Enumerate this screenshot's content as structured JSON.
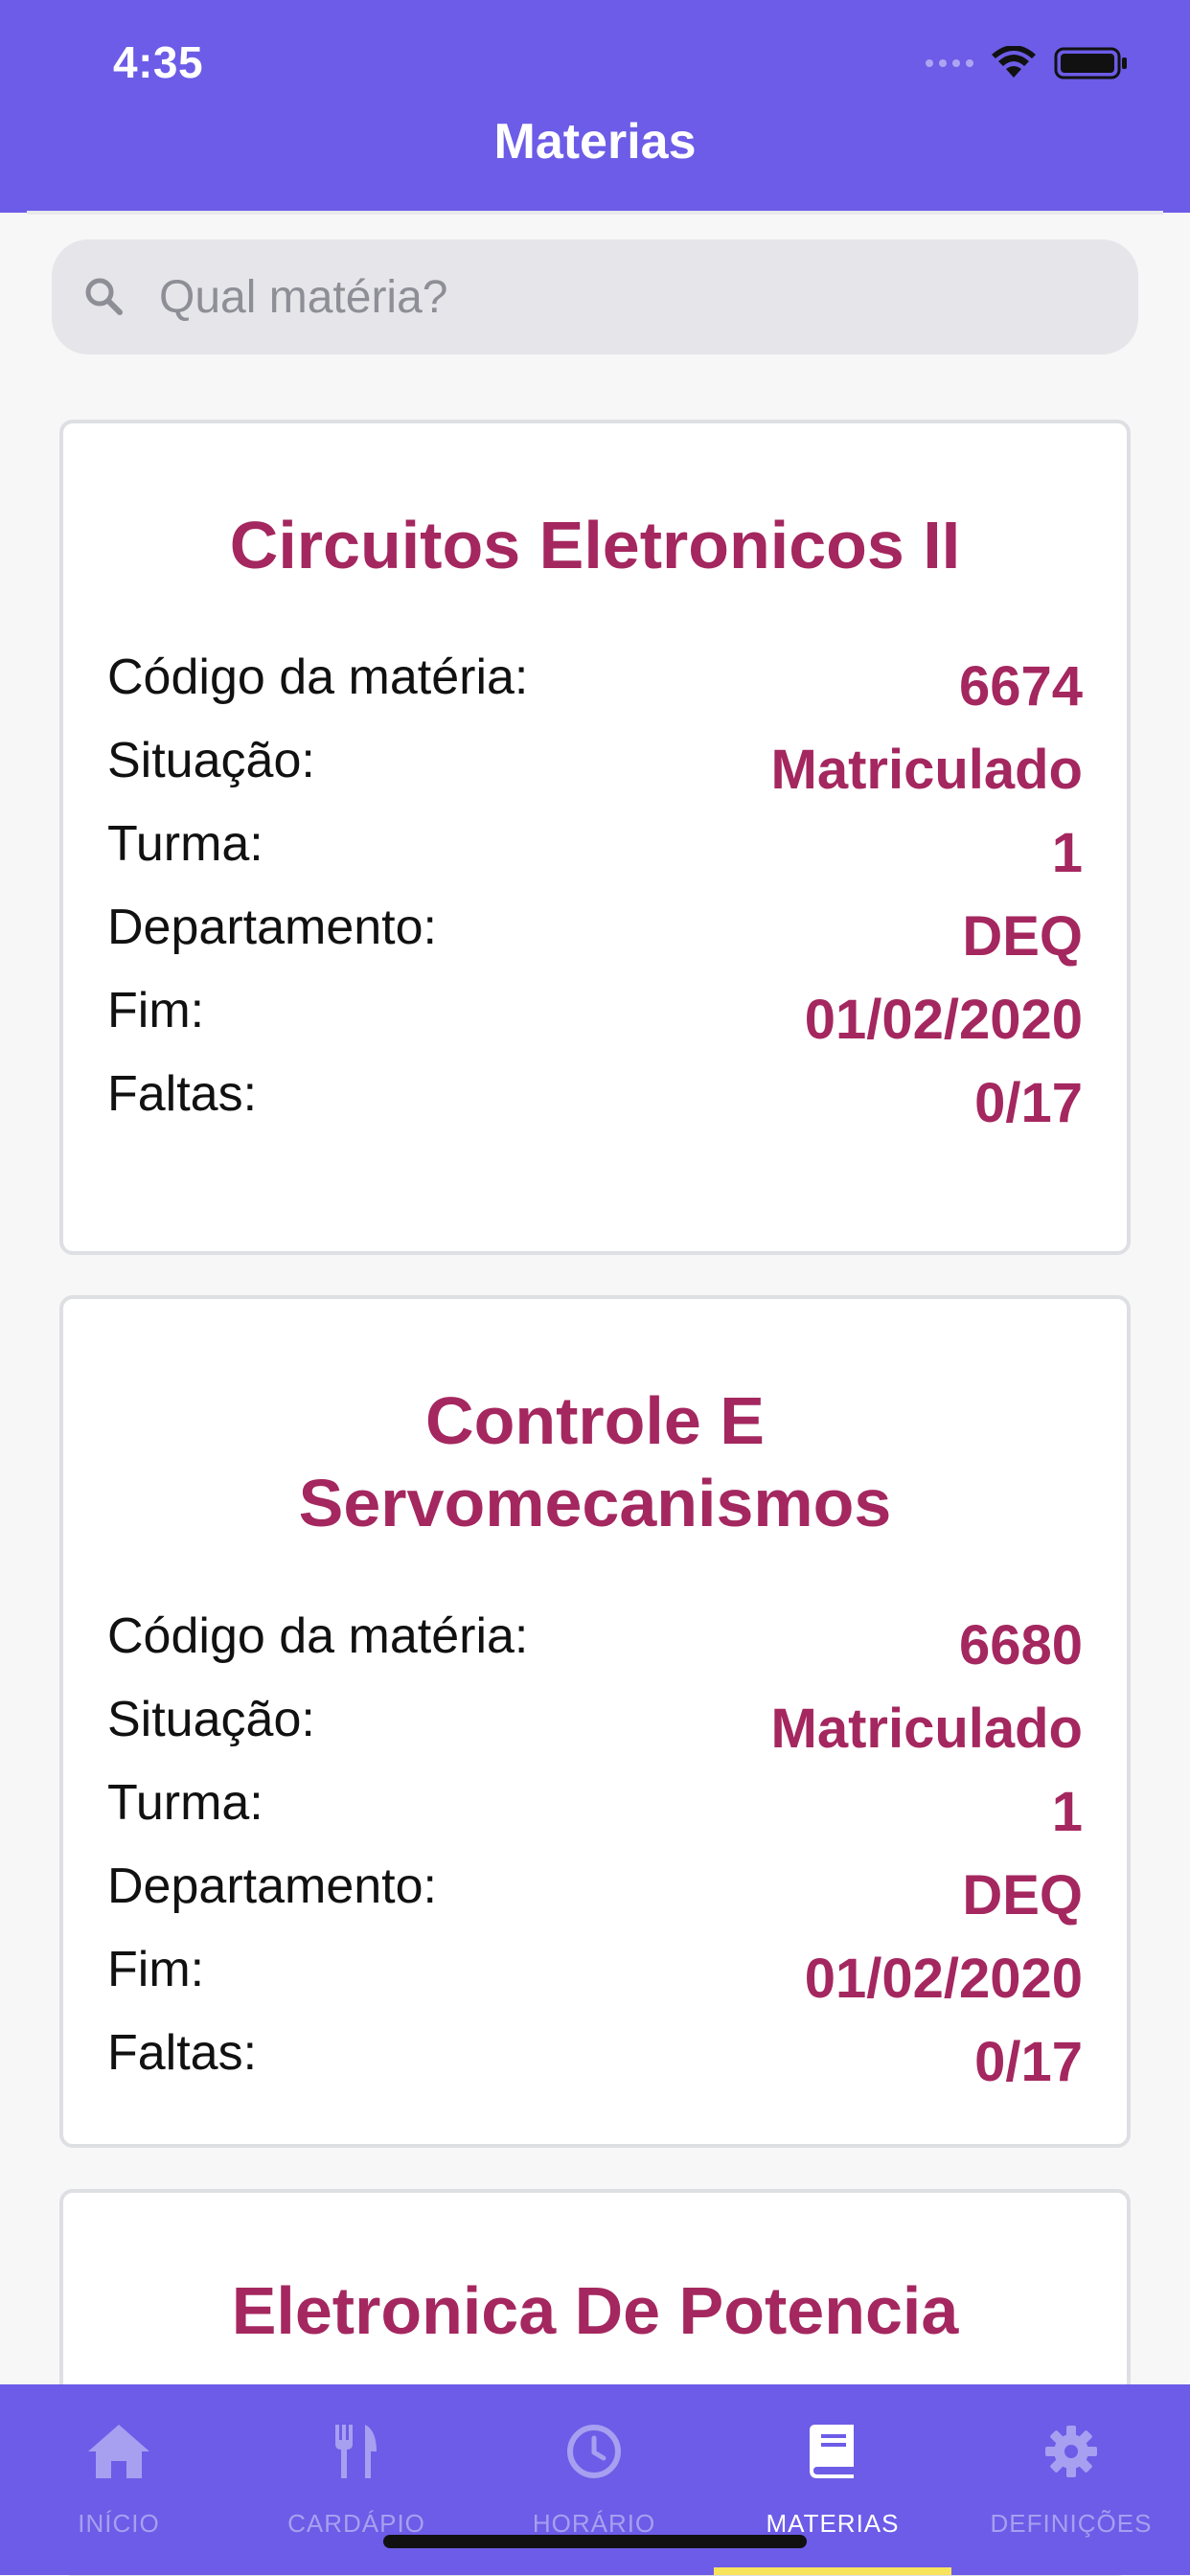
{
  "status_bar": {
    "time": "4:35"
  },
  "header": {
    "title": "Materias",
    "background": "#6c5ce7"
  },
  "search": {
    "placeholder": "Qual matéria?",
    "value": ""
  },
  "labels": {
    "code": "Código da matéria:",
    "status": "Situação:",
    "class": "Turma:",
    "department": "Departamento:",
    "end": "Fim:",
    "absences": "Faltas:"
  },
  "courses": [
    {
      "title": "Circuitos Eletronicos II",
      "code": "6674",
      "status": "Matriculado",
      "class": "1",
      "department": "DEQ",
      "end": "01/02/2020",
      "absences": "0/17"
    },
    {
      "title": "Controle E Servomecanismos",
      "code": "6680",
      "status": "Matriculado",
      "class": "1",
      "department": "DEQ",
      "end": "01/02/2020",
      "absences": "0/17"
    },
    {
      "title": "Eletronica De Potencia"
    }
  ],
  "tabbar": {
    "tabs": [
      {
        "label": "INÍCIO",
        "icon": "home-icon"
      },
      {
        "label": "CARDÁPIO",
        "icon": "utensils-icon"
      },
      {
        "label": "HORÁRIO",
        "icon": "clock-icon"
      },
      {
        "label": "MATERIAS",
        "icon": "book-icon",
        "active": true
      },
      {
        "label": "DEFINIÇÕES",
        "icon": "gear-icon"
      }
    ]
  },
  "colors": {
    "accent": "#a4275f",
    "tab_indicator": "#f8e45c",
    "inactive_icon": "#a79ff0"
  }
}
